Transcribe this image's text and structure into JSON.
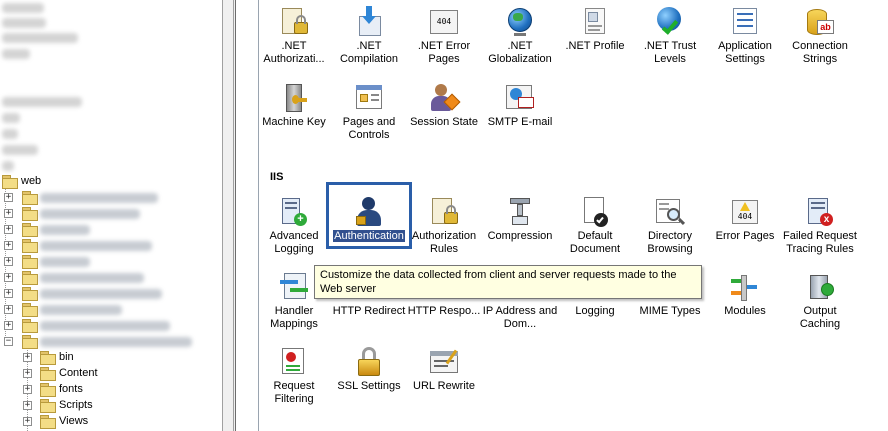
{
  "tree": {
    "top_root_label": "web",
    "children": [
      "bin",
      "Content",
      "fonts",
      "Scripts",
      "Views"
    ]
  },
  "aspnet_features": [
    {
      "label": ".NET Authorizati...",
      "icon": "net-authorization-icon"
    },
    {
      "label": ".NET Compilation",
      "icon": "net-compilation-icon"
    },
    {
      "label": ".NET Error Pages",
      "icon": "net-error-pages-icon"
    },
    {
      "label": ".NET Globalization",
      "icon": "net-globalization-icon"
    },
    {
      "label": ".NET Profile",
      "icon": "net-profile-icon"
    },
    {
      "label": ".NET Trust Levels",
      "icon": "net-trust-levels-icon"
    },
    {
      "label": "Application Settings",
      "icon": "application-settings-icon"
    },
    {
      "label": "Connection Strings",
      "icon": "connection-strings-icon"
    },
    {
      "label": "Machine Key",
      "icon": "machine-key-icon"
    },
    {
      "label": "Pages and Controls",
      "icon": "pages-and-controls-icon"
    },
    {
      "label": "Session State",
      "icon": "session-state-icon"
    },
    {
      "label": "SMTP E-mail",
      "icon": "smtp-email-icon"
    }
  ],
  "iis_section_title": "IIS",
  "iis_features": [
    {
      "label": "Advanced Logging",
      "icon": "advanced-logging-icon"
    },
    {
      "label": "Authentication",
      "icon": "authentication-icon",
      "selected": true
    },
    {
      "label": "Authorization Rules",
      "icon": "authorization-rules-icon"
    },
    {
      "label": "Compression",
      "icon": "compression-icon"
    },
    {
      "label": "Default Document",
      "icon": "default-document-icon"
    },
    {
      "label": "Directory Browsing",
      "icon": "directory-browsing-icon"
    },
    {
      "label": "Error Pages",
      "icon": "error-pages-icon"
    },
    {
      "label": "Failed Request Tracing Rules",
      "icon": "failed-request-tracing-icon"
    },
    {
      "label": "Handler Mappings",
      "icon": "handler-mappings-icon"
    },
    {
      "label": "HTTP Redirect",
      "icon": "http-redirect-icon"
    },
    {
      "label": "HTTP Respo...",
      "icon": "http-response-headers-icon"
    },
    {
      "label": "IP Address and Dom...",
      "icon": "ip-address-domain-icon"
    },
    {
      "label": "Logging",
      "icon": "logging-icon"
    },
    {
      "label": "MIME Types",
      "icon": "mime-types-icon"
    },
    {
      "label": "Modules",
      "icon": "modules-icon"
    },
    {
      "label": "Output Caching",
      "icon": "output-caching-icon"
    },
    {
      "label": "Request Filtering",
      "icon": "request-filtering-icon"
    },
    {
      "label": "SSL Settings",
      "icon": "ssl-settings-icon"
    },
    {
      "label": "URL Rewrite",
      "icon": "url-rewrite-icon"
    }
  ],
  "tooltip": "Customize the data collected from client and server requests made to the Web server",
  "colors": {
    "selection_border": "#2a5ea9",
    "tooltip_bg": "#ffffe1",
    "selected_label_bg": "#31508f"
  }
}
